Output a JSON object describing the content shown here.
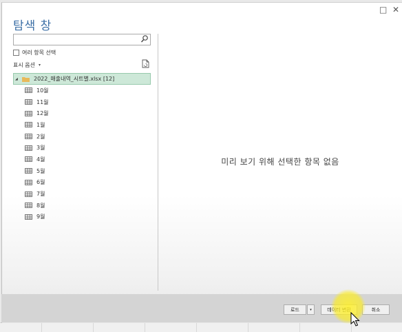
{
  "dialog": {
    "title": "탐색 창",
    "maximize_icon": "□",
    "close_icon": "✕"
  },
  "left_panel": {
    "search": {
      "value": "",
      "placeholder": ""
    },
    "multi_select_label": "여러 항목 선택",
    "display_options_label": "표시 옵션",
    "display_options_caret": "▾",
    "tree": {
      "root": {
        "label": "2022_매출내역_시트별.xlsx [12]",
        "expanded": true
      },
      "sheets": [
        "10월",
        "11월",
        "12월",
        "1월",
        "2월",
        "3월",
        "4월",
        "5월",
        "6월",
        "7월",
        "8월",
        "9월"
      ]
    }
  },
  "preview": {
    "empty_message": "미리 보기 위해 선택한 항목 없음"
  },
  "footer": {
    "load_label": "로드",
    "load_dropdown": "▾",
    "transform_label": "데이터 변환",
    "cancel_label": "취소"
  },
  "colors": {
    "title": "#3c6fa6",
    "root_highlight": "#cde8d8",
    "folder": "#e8b95a",
    "cursor_highlight": "#f9e82a"
  }
}
